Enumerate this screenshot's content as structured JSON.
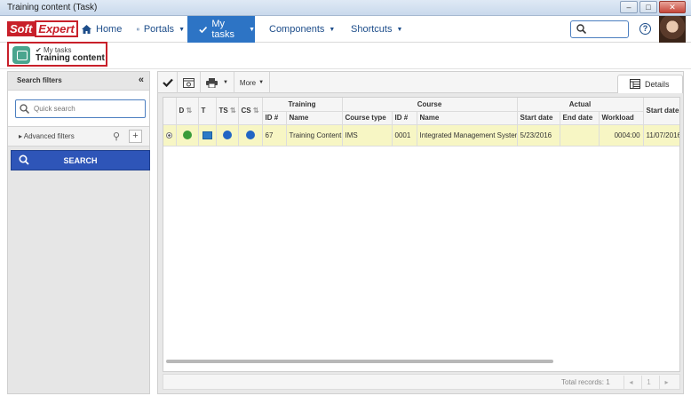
{
  "window": {
    "title": "Training content (Task)",
    "controls": [
      "–",
      "□",
      "✕"
    ]
  },
  "logo": {
    "soft": "Soft",
    "expert": "Expert"
  },
  "nav": {
    "items": [
      {
        "label": "Home",
        "icon": "home-icon",
        "active": false
      },
      {
        "label": "Portals",
        "icon": "portals-icon",
        "active": false
      },
      {
        "label": "My tasks",
        "icon": "check-icon",
        "active": true
      },
      {
        "label": "Components",
        "icon": "trophy-icon",
        "active": false
      },
      {
        "label": "Shortcuts",
        "icon": "lightning-icon",
        "active": false
      }
    ],
    "search_icon": "search-icon",
    "help_label": "?"
  },
  "breadcrumb": {
    "parent": "My tasks",
    "title": "Training content"
  },
  "filters": {
    "title": "Search filters",
    "collapse_label": "«",
    "quick_search_placeholder": "Quick search",
    "advanced_label": "Advanced filters",
    "add_label": "+",
    "search_button": "SEARCH"
  },
  "toolbar": {
    "more_label": "More",
    "details_tab": "Details"
  },
  "grid": {
    "group_headers": {
      "training": "Training",
      "course": "Course",
      "actual": "Actual"
    },
    "columns": {
      "d": "D",
      "t": "T",
      "ts": "TS",
      "cs": "CS",
      "training_id": "ID #",
      "training_name": "Name",
      "course_type": "Course type",
      "course_id": "ID #",
      "course_name": "Name",
      "actual_start": "Start date",
      "actual_end": "End date",
      "workload": "Workload",
      "start_date": "Start date"
    },
    "rows": [
      {
        "training_id": "67",
        "training_name": "Training Content",
        "course_type": "IMS",
        "course_id": "0001",
        "course_name": "Integrated Management System",
        "actual_start": "5/23/2016",
        "actual_end": "",
        "workload": "0004:00",
        "start_date": "11/07/2016"
      }
    ],
    "footer": {
      "total_label": "Total records: 1",
      "page": "1"
    }
  },
  "colors": {
    "nav_active": "#2d74c5",
    "row_highlight": "#f7f6c4",
    "search_button": "#2e55b8",
    "breadcrumb_border": "#c8202a"
  }
}
